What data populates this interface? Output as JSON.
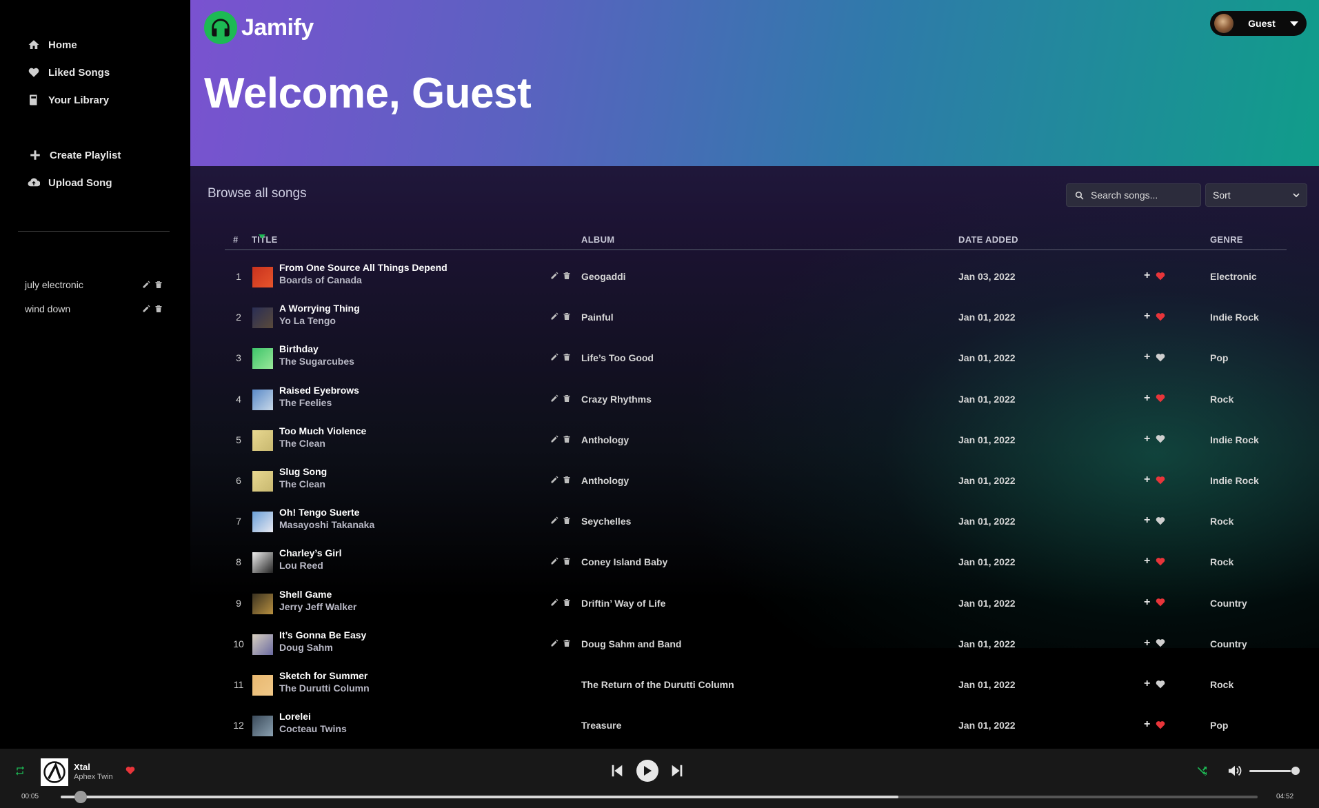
{
  "sidebar": {
    "nav": [
      {
        "label": "Home",
        "icon": "home-icon"
      },
      {
        "label": "Liked Songs",
        "icon": "heart-icon"
      },
      {
        "label": "Your Library",
        "icon": "library-icon"
      },
      {
        "label": "Create Playlist",
        "icon": "plus-icon"
      },
      {
        "label": "Upload Song",
        "icon": "cloud-upload-icon"
      }
    ],
    "playlists": [
      {
        "label": "july electronic"
      },
      {
        "label": "wind down"
      }
    ]
  },
  "header": {
    "brand": "Jamify",
    "welcome": "Welcome, Guest",
    "user": "Guest"
  },
  "browse": {
    "heading": "Browse all songs",
    "search_placeholder": "Search songs...",
    "sort_label": "Sort"
  },
  "table": {
    "columns": {
      "num": "#",
      "title": "TITLE",
      "album": "ALBUM",
      "date": "DATE ADDED",
      "genre": "GENRE"
    },
    "rows": [
      {
        "num": "1",
        "title": "From One Source All Things Depend",
        "artist": "Boards of Canada",
        "album": "Geogaddi",
        "date": "Jan 03, 2022",
        "genre": "Electronic",
        "liked": true,
        "editable": true,
        "art": [
          "#c8321e",
          "#e8552c"
        ]
      },
      {
        "num": "2",
        "title": "A Worrying Thing",
        "artist": "Yo La Tengo",
        "album": "Painful",
        "date": "Jan 01, 2022",
        "genre": "Indie Rock",
        "liked": true,
        "editable": true,
        "art": [
          "#2a2e55",
          "#5a4a3a"
        ]
      },
      {
        "num": "3",
        "title": "Birthday",
        "artist": "The Sugarcubes",
        "album": "Life’s Too Good",
        "date": "Jan 01, 2022",
        "genre": "Pop",
        "liked": false,
        "editable": true,
        "art": [
          "#3ec46a",
          "#9ae89a"
        ]
      },
      {
        "num": "4",
        "title": "Raised Eyebrows",
        "artist": "The Feelies",
        "album": "Crazy Rhythms",
        "date": "Jan 01, 2022",
        "genre": "Rock",
        "liked": true,
        "editable": true,
        "art": [
          "#5a8ac8",
          "#c8d8e8"
        ]
      },
      {
        "num": "5",
        "title": "Too Much Violence",
        "artist": "The Clean",
        "album": "Anthology",
        "date": "Jan 01, 2022",
        "genre": "Indie Rock",
        "liked": false,
        "editable": true,
        "art": [
          "#e8d890",
          "#c8b870"
        ]
      },
      {
        "num": "6",
        "title": "Slug Song",
        "artist": "The Clean",
        "album": "Anthology",
        "date": "Jan 01, 2022",
        "genre": "Indie Rock",
        "liked": true,
        "editable": true,
        "art": [
          "#e8d890",
          "#c8b870"
        ]
      },
      {
        "num": "7",
        "title": "Oh! Tengo Suerte",
        "artist": "Masayoshi Takanaka",
        "album": "Seychelles",
        "date": "Jan 01, 2022",
        "genre": "Rock",
        "liked": false,
        "editable": true,
        "art": [
          "#6aa0d8",
          "#e8e8f0"
        ]
      },
      {
        "num": "8",
        "title": "Charley’s Girl",
        "artist": "Lou Reed",
        "album": "Coney Island Baby",
        "date": "Jan 01, 2022",
        "genre": "Rock",
        "liked": true,
        "editable": true,
        "art": [
          "#f0f0f0",
          "#222222"
        ]
      },
      {
        "num": "9",
        "title": "Shell Game",
        "artist": "Jerry Jeff Walker",
        "album": "Driftin’ Way of Life",
        "date": "Jan 01, 2022",
        "genre": "Country",
        "liked": true,
        "editable": true,
        "art": [
          "#3a3220",
          "#b89040"
        ]
      },
      {
        "num": "10",
        "title": "It’s Gonna Be Easy",
        "artist": "Doug Sahm",
        "album": "Doug Sahm and Band",
        "date": "Jan 01, 2022",
        "genre": "Country",
        "liked": false,
        "editable": true,
        "art": [
          "#d8d0c0",
          "#6a6aa0"
        ]
      },
      {
        "num": "11",
        "title": "Sketch for Summer",
        "artist": "The Durutti Column",
        "album": "The Return of the Durutti Column",
        "date": "Jan 01, 2022",
        "genre": "Rock",
        "liked": false,
        "editable": false,
        "art": [
          "#e8b870",
          "#f0c888"
        ]
      },
      {
        "num": "12",
        "title": "Lorelei",
        "artist": "Cocteau Twins",
        "album": "Treasure",
        "date": "Jan 01, 2022",
        "genre": "Pop",
        "liked": true,
        "editable": false,
        "art": [
          "#3a4a5a",
          "#8aa0b0"
        ]
      }
    ]
  },
  "player": {
    "title": "Xtal",
    "artist": "Aphex Twin",
    "liked": true,
    "current_time": "00:05",
    "total_time": "04:52",
    "progress": 0.7,
    "volume": 0.9
  },
  "colors": {
    "accent": "#1db954",
    "heart_liked": "#e8353a",
    "heart_unliked": "#cfcfcf"
  }
}
